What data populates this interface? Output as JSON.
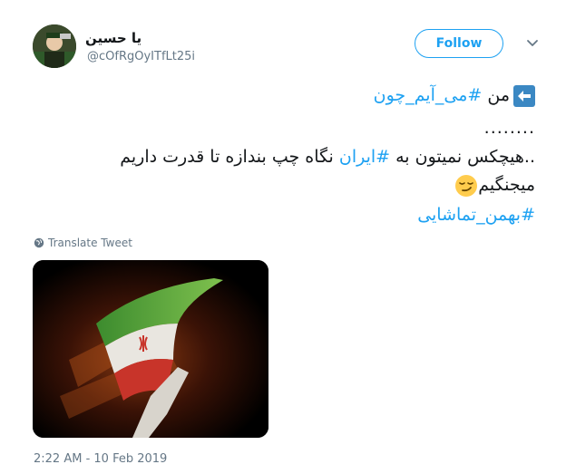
{
  "author": {
    "name": "یا حسین",
    "handle": "@cOfRgOyITfLt25i"
  },
  "follow_label": "Follow",
  "tweet": {
    "line1": {
      "word": "من",
      "tag": "#می_آیم_چون"
    },
    "line2": "........",
    "line3": {
      "prefix": "..هیچکس نمیتون به ",
      "tag": "#ایران",
      "suffix": " نگاه چپ بندازه تا قدرت  داریم"
    },
    "line4": "میجنگیم",
    "line5": {
      "tag": "#بهمن_تماشایی"
    }
  },
  "translate_label": "Translate Tweet",
  "timestamp": "2:22 AM - 10 Feb 2019",
  "colors": {
    "accent": "#1da1f2",
    "secondary_text": "#657786"
  },
  "icons": [
    "left-arrow-emoji-icon",
    "smirk-emoji-icon",
    "globe-icon",
    "chevron-down-icon"
  ]
}
